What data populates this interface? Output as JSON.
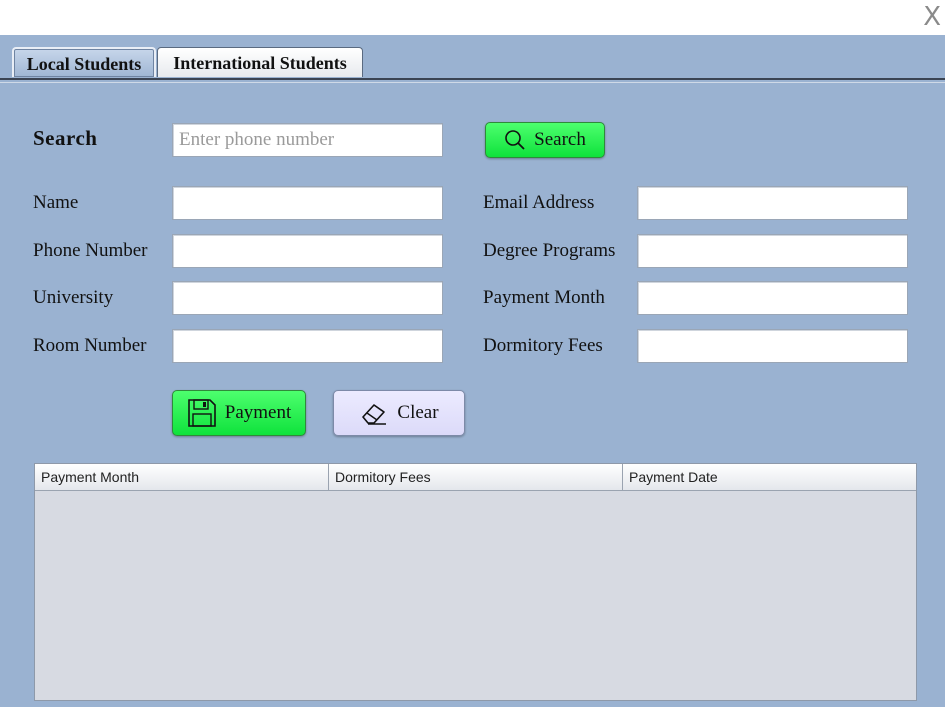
{
  "window": {
    "close_label": "X"
  },
  "tabs": [
    {
      "label": "Local Students",
      "active": true
    },
    {
      "label": "International Students",
      "active": false
    }
  ],
  "search": {
    "label": "Search",
    "placeholder": "Enter phone number",
    "value": "",
    "button_label": "Search"
  },
  "form": {
    "name_label": "Name",
    "phone_label": "Phone Number",
    "university_label": "University",
    "room_label": "Room Number",
    "email_label": "Email Address",
    "degree_label": "Degree Programs",
    "payment_month_label": "Payment Month",
    "dorm_fees_label": "Dormitory Fees"
  },
  "actions": {
    "payment_label": "Payment",
    "clear_label": "Clear"
  },
  "table": {
    "columns": [
      "Payment Month",
      "Dormitory Fees",
      "Payment Date"
    ],
    "rows": []
  },
  "colors": {
    "panel": "#9ab2d1",
    "accent_green": "#1ee84a",
    "table_bg": "#d7dae2"
  }
}
